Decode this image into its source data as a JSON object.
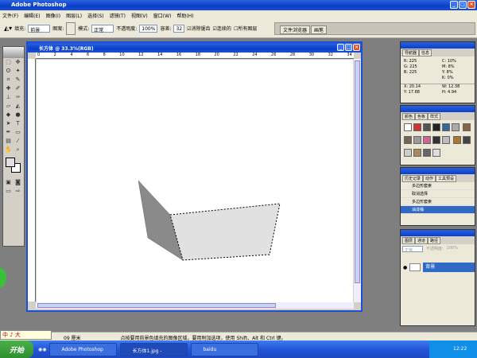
{
  "app": {
    "title": "Adobe Photoshop"
  },
  "menu": [
    "文件(F)",
    "编辑(E)",
    "图像(I)",
    "图层(L)",
    "选择(S)",
    "滤镜(T)",
    "视图(V)",
    "窗口(W)",
    "帮助(H)"
  ],
  "options": {
    "fill_label": "填充:",
    "fill_value": "前景",
    "pattern_label": "图案:",
    "mode_label": "模式:",
    "mode_value": "正常",
    "opacity_label": "不透明度:",
    "opacity_value": "100%",
    "tolerance_label": "容差:",
    "tolerance_value": "32",
    "antialias": "消除锯齿",
    "contiguous": "连续的",
    "all_layers": "所有图层"
  },
  "dock_tabs": [
    "文件浏览器",
    "画笔"
  ],
  "document": {
    "title": "长方体 @ 33.3%(RGB)",
    "ruler_marks": [
      "0",
      "2",
      "4",
      "6",
      "8",
      "10",
      "12",
      "14",
      "16",
      "18",
      "20",
      "22",
      "24",
      "26",
      "28",
      "30",
      "32",
      "34"
    ]
  },
  "info_panel": {
    "tabs": [
      "导航器",
      "信息"
    ],
    "R": "225",
    "G": "225",
    "B": "225",
    "C": "10%",
    "M": "8%",
    "Y": "8%",
    "K": "0%",
    "X": "20.14",
    "Y_coord": "17.88",
    "W": "12.38",
    "H": "4.94"
  },
  "swatch_panel": {
    "tabs": [
      "颜色",
      "色板",
      "样式"
    ]
  },
  "history_panel": {
    "tabs": [
      "历史记录",
      "动作",
      "工具预设"
    ],
    "items": [
      "多边形套索",
      "取消选择",
      "多边形套索",
      "油漆桶"
    ],
    "active_index": 3
  },
  "layers_panel": {
    "tabs": [
      "图层",
      "通道",
      "路径"
    ],
    "blend": "正常",
    "opacity_label": "不透明度:",
    "opacity": "100%",
    "layer_name": "背景"
  },
  "status": {
    "zoom": "33.33%",
    "doc": "09 厘米",
    "hint": "点按要用前景色填充的图像区域，要用附加选项，使用 Shift、Alt 和 Ctrl 键。"
  },
  "ime": "中 ♪ 大",
  "taskbar": {
    "start": "开始",
    "tasks": [
      "Adobe Photoshop",
      "长方体1.jpg -",
      "baidu"
    ],
    "clock": "12:22"
  },
  "colors": {
    "accent": "#0a3fc8",
    "fill_light": "#e1e1e1",
    "fill_dark": "#8a8a8a"
  }
}
